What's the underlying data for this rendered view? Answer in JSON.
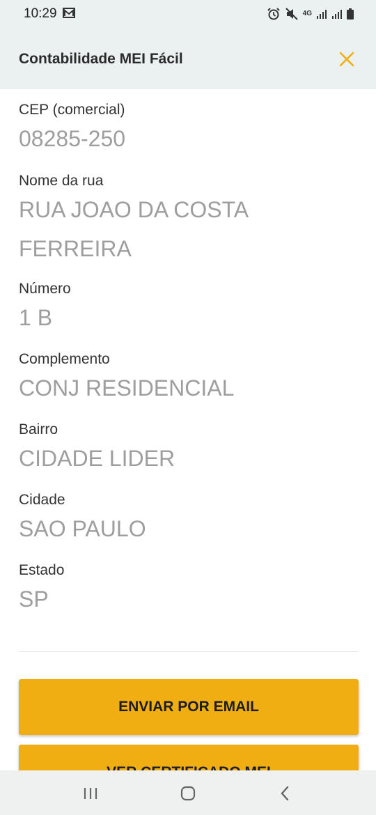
{
  "status_bar": {
    "time": "10:29",
    "network": "4G"
  },
  "header": {
    "title": "Contabilidade MEI Fácil",
    "close_icon": "close-icon",
    "accent_color": "#f0ae12"
  },
  "fields": [
    {
      "label": "CEP (comercial)",
      "lines": [
        "08285-250"
      ]
    },
    {
      "label": "Nome da rua",
      "lines": [
        "RUA JOAO DA COSTA",
        "FERREIRA"
      ]
    },
    {
      "label": "Número",
      "lines": [
        "1 B"
      ]
    },
    {
      "label": "Complemento",
      "lines": [
        "CONJ RESIDENCIAL"
      ]
    },
    {
      "label": "Bairro",
      "lines": [
        "CIDADE LIDER"
      ]
    },
    {
      "label": "Cidade",
      "lines": [
        "SAO PAULO"
      ]
    },
    {
      "label": "Estado",
      "lines": [
        "SP"
      ]
    }
  ],
  "buttons": {
    "email": "ENVIAR POR EMAIL",
    "certificate": "VER CERTIFICADO MEI"
  },
  "nav_icons": [
    "recent-apps-icon",
    "home-icon",
    "back-icon"
  ]
}
